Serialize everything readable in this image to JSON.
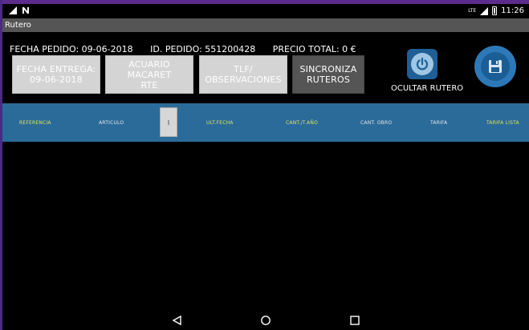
{
  "status": {
    "time": "11:26",
    "network": "LTE"
  },
  "window": {
    "title": "Rutero"
  },
  "order": {
    "fecha_pedido": "FECHA PEDIDO: 09-06-2018",
    "id_pedido": "ID. PEDIDO: 551200428",
    "precio_total": "PRECIO TOTAL: 0 €"
  },
  "buttons": {
    "fecha_entrega_line1": "FECHA ENTREGA:",
    "fecha_entrega_line2": "09-06-2018",
    "cliente_line1": "ACUARIO MACARET",
    "cliente_line2": "RTE",
    "tlf_line1": "TLF/",
    "tlf_line2": "OBSERVACIONES",
    "sync_line1": "SINCRONIZA",
    "sync_line2": "RUTEROS",
    "ocultar_label": "OCULTAR RUTERO"
  },
  "table": {
    "columns": [
      "REFERENCIA",
      "ARTICULO",
      "ULT.FECHA",
      "CANT./T.AÑO",
      "CANT. OBRO",
      "TARIFA",
      "TARIFA LISTA"
    ]
  },
  "colors": {
    "accent_blue": "#2b6b9a",
    "header_yellow": "#e3e25a",
    "button_grey": "#d4d4d4",
    "button_dark": "#555555"
  }
}
